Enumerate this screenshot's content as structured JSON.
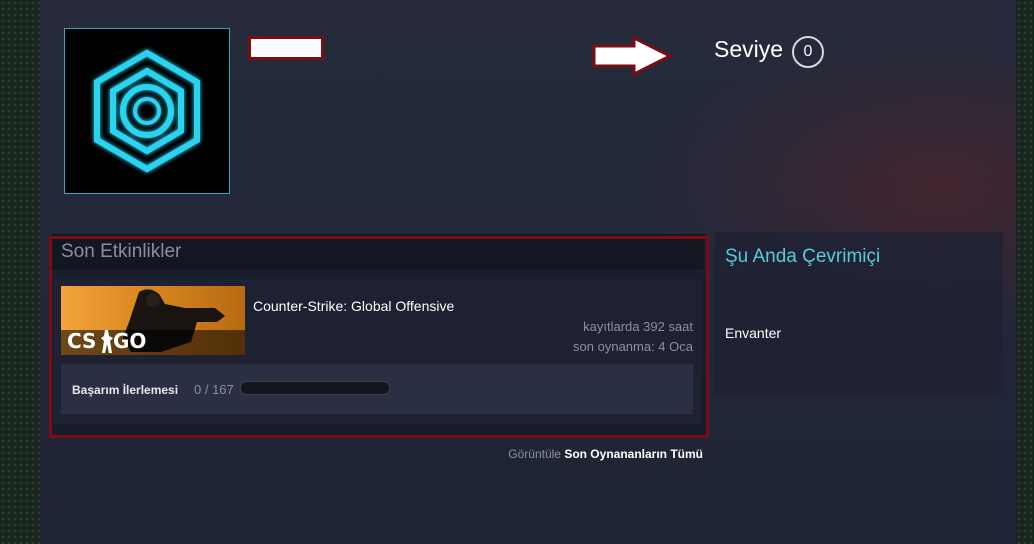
{
  "profile": {
    "level_label": "Seviye",
    "level_value": "0",
    "avatar_icon": "hexagon-rings-icon",
    "name_redacted": true
  },
  "annotations": {
    "arrow_icon": "right-arrow-icon",
    "highlight_color": "#7a0c12"
  },
  "activity": {
    "title": "Son Etkinlikler",
    "game": {
      "name": "Counter-Strike: Global Offensive",
      "capsule_icon": "csgo-capsule-icon",
      "hours": "kayıtlarda 392 saat",
      "last_played": "son oynanma: 4 Oca",
      "achievement_label": "Başarım İlerlemesi",
      "achievement_count": "0 / 167",
      "achievement_progress": 0
    },
    "view_all_prefix": "Görüntüle",
    "view_all_link": "Son Oynananların Tümü"
  },
  "online": {
    "title": "Şu Anda Çevrimiçi",
    "inventory": "Envanter"
  },
  "colors": {
    "accent_cyan": "#57cbde",
    "progress_blue": "#66c0f4"
  }
}
